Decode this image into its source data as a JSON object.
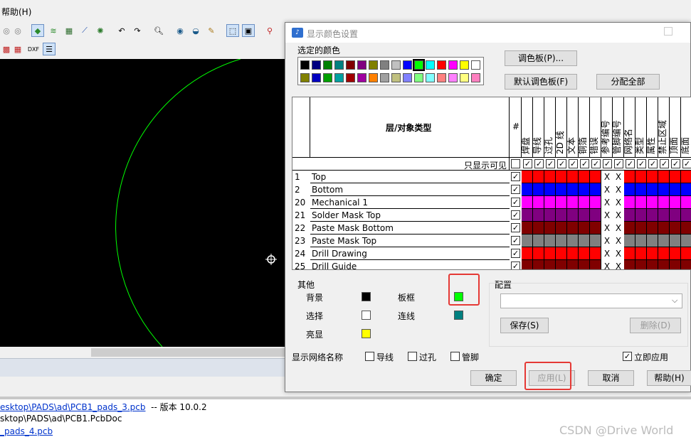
{
  "menubar": {
    "help": "帮助(H)"
  },
  "output": {
    "line1_path": "esktop\\PADS\\ad\\PCB1_pads_3.pcb",
    "line1_suffix": "-- 版本 10.0.2",
    "line2": "sktop\\PADS\\ad\\PCB1.PcbDoc",
    "line3_path": "_pads_4.pcb"
  },
  "watermark": "CSDN @Drive World",
  "dialog": {
    "title": "显示颜色设置",
    "selected_colors_label": "选定的颜色",
    "palette_row1": [
      "#000000",
      "#000080",
      "#008000",
      "#008080",
      "#800000",
      "#800080",
      "#808000",
      "#808080",
      "#c0c0c0",
      "#0000ff",
      "#00ff00",
      "#00ffff",
      "#ff0000",
      "#ff00ff",
      "#ffff00",
      "#ffffff"
    ],
    "palette_row2": [
      "#808000",
      "#0000c0",
      "#00a000",
      "#00a0a0",
      "#a00000",
      "#a000a0",
      "#ff8000",
      "#a0a0a0",
      "#c0c080",
      "#8080ff",
      "#80ff80",
      "#80ffff",
      "#ff8080",
      "#ff80ff",
      "#ffff80",
      "#ff80c0"
    ],
    "btn_palette": "调色板(P)...",
    "btn_default_palette": "默认调色板(F)",
    "btn_assign_all": "分配全部",
    "grid": {
      "header_type": "层/对象类型",
      "header_hash": "#",
      "columns": [
        "焊盘",
        "导线",
        "过孔",
        "2D 线",
        "文本",
        "铜箔",
        "错误",
        "参考编号",
        "管脚编号",
        "网络名",
        "类型",
        "属性",
        "禁止区域",
        "顶面",
        "底面"
      ],
      "visible_only": "只显示可见",
      "rows": [
        {
          "num": "1",
          "name": "Top",
          "color": "#ff0000"
        },
        {
          "num": "2",
          "name": "Bottom",
          "color": "#0000ff"
        },
        {
          "num": "20",
          "name": "Mechanical 1",
          "color": "#ff00ff"
        },
        {
          "num": "21",
          "name": "Solder Mask Top",
          "color": "#800080"
        },
        {
          "num": "22",
          "name": "Paste Mask Bottom",
          "color": "#800000"
        },
        {
          "num": "23",
          "name": "Paste Mask Top",
          "color": "#808080"
        },
        {
          "num": "24",
          "name": "Drill Drawing",
          "color": "#ff0000"
        },
        {
          "num": "25",
          "name": "Drill Guide",
          "color": "#800000"
        }
      ],
      "x_mark": "X"
    },
    "other": {
      "title": "其他",
      "background": "背景",
      "selection": "选择",
      "highlight": "亮显",
      "board_frame": "板框",
      "connection": "连线",
      "colors": {
        "background": "#000000",
        "selection": "#ffffff",
        "highlight": "#ffff00",
        "board_frame": "#00ff00",
        "connection": "#008080"
      }
    },
    "config": {
      "title": "配置",
      "selected": "",
      "btn_save": "保存(S)",
      "btn_delete": "删除(D)"
    },
    "net_names": {
      "label": "显示网络名称",
      "trace": "导线",
      "via": "过孔",
      "pin": "管脚"
    },
    "apply_immediately": "立即应用",
    "btn_ok": "确定",
    "btn_apply": "应用(L)",
    "btn_cancel": "取消",
    "btn_help": "帮助(H)"
  }
}
